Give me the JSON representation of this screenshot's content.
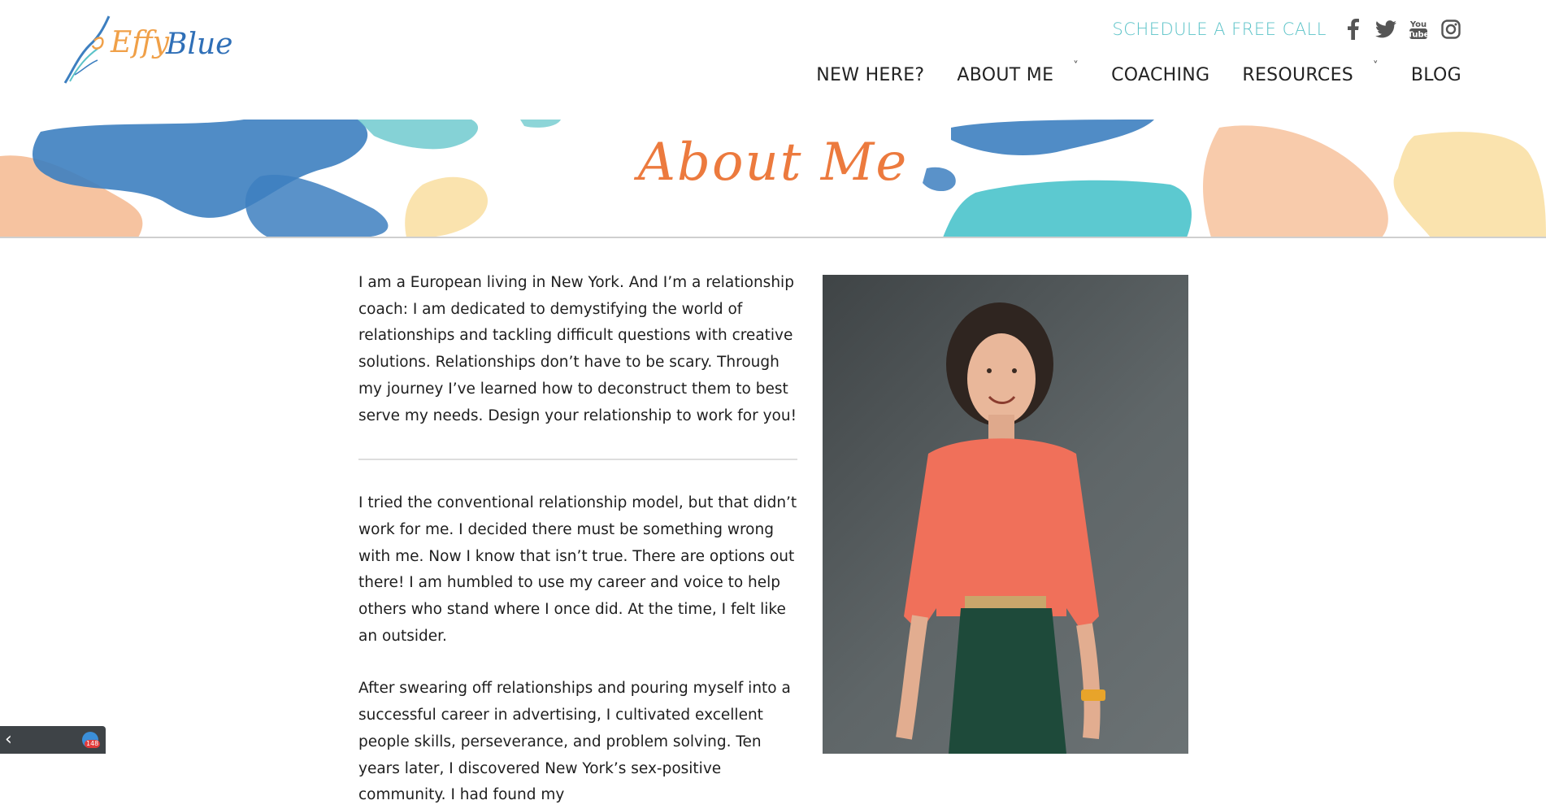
{
  "header": {
    "logo_text": "EffyBlue",
    "schedule_label": "SCHEDULE A FREE CALL",
    "social": [
      {
        "name": "facebook-icon",
        "glyph": "f"
      },
      {
        "name": "twitter-icon",
        "glyph": "twitter"
      },
      {
        "name": "youtube-icon",
        "glyph": "You Tube"
      },
      {
        "name": "instagram-icon",
        "glyph": "instagram"
      }
    ]
  },
  "nav": {
    "items": [
      {
        "label": "NEW HERE?",
        "has_dropdown": false
      },
      {
        "label": "ABOUT ME",
        "has_dropdown": true
      },
      {
        "label": "COACHING",
        "has_dropdown": false
      },
      {
        "label": "RESOURCES",
        "has_dropdown": true
      },
      {
        "label": "BLOG",
        "has_dropdown": false
      }
    ],
    "chevron": "˅"
  },
  "banner": {
    "title": "About Me"
  },
  "content": {
    "paragraphs": [
      "I am a European living in New York. And I’m a relationship coach: I am dedicated to demystifying the world of relationships and tackling difficult questions with creative solutions. Relationships don’t have to be scary. Through my journey I’ve learned how to deconstruct them to best serve my needs. Design your relationship to work for you!",
      "I tried the conventional relationship model, but that didn’t work for me. I decided there must be something wrong with me. Now I know that isn’t true. There are options out there! I am humbled to use my career and voice to help others who stand where I once did. At the time, I felt like an outsider.",
      "After swearing off relationships and pouring myself into a successful career in advertising, I cultivated excellent people skills, perseverance, and problem solving. Ten years later, I discovered New York’s sex-positive community. I had found my"
    ]
  },
  "widget": {
    "arrow": "‹",
    "count": "148"
  },
  "colors": {
    "accent_teal": "#5cc3c8",
    "accent_orange": "#ec7a3e",
    "blue": "#3d7fc0",
    "peach": "#f5b98f"
  }
}
